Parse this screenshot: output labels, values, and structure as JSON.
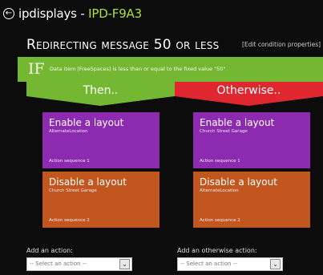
{
  "header": {
    "brand_prefix": "ip",
    "brand_suffix": "displays",
    "separator": " - ",
    "device": "IPD-F9A3",
    "back_icon": "back-arrow-icon"
  },
  "rule": {
    "title": "Redirecting message 50 or less",
    "edit_link": "[Edit condition properties]",
    "if_label": "IF",
    "condition": "Data item [FreeSpaces] is less than or equal to the fixed value \"50\"",
    "then_label": "Then..",
    "otherwise_label": "Otherwise..",
    "colors": {
      "if_bar": "#74b733",
      "then": "#74b733",
      "otherwise": "#e0262e",
      "enable_tile": "#8c2bb0",
      "disable_tile": "#c1571e",
      "device_name": "#aee03a"
    }
  },
  "then_actions": [
    {
      "title": "Enable a layout",
      "target": "AlternateLocation",
      "sequence": "Action sequence 1"
    },
    {
      "title": "Disable a layout",
      "target": "Church Street Garage",
      "sequence": "Action sequence 2"
    }
  ],
  "otherwise_actions": [
    {
      "title": "Enable a layout",
      "target": "Church Street Garage",
      "sequence": "Action sequence 1"
    },
    {
      "title": "Disable a layout",
      "target": "AlternateLocation",
      "sequence": "Action sequence 2"
    }
  ],
  "add_action": {
    "label": "Add an action:",
    "placeholder": "-- Select an action --"
  },
  "add_otherwise_action": {
    "label": "Add an otherwise action:",
    "placeholder": "-- Select an action --"
  }
}
